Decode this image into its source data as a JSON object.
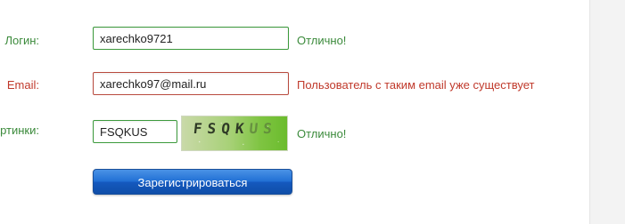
{
  "form": {
    "login": {
      "label": "Логин:",
      "value": "xarechko9721",
      "message": "Отлично!",
      "status": "ok"
    },
    "email": {
      "label": "Email:",
      "value": "xarechko97@mail.ru",
      "message": "Пользователь с таким email уже существует",
      "status": "error"
    },
    "captcha": {
      "label": "д с картинки:",
      "value": "FSQKUS",
      "message": "Отлично!",
      "status": "ok",
      "image_text_main": "FSQK",
      "image_text_faded": "US"
    },
    "submit_label": "Зарегистрироваться"
  },
  "colors": {
    "ok_text": "#3b8a3b",
    "error_text": "#c0392b",
    "ok_border": "#3c9a3c",
    "error_border": "#b84a3e",
    "button_blue": "#1f6ed4"
  }
}
